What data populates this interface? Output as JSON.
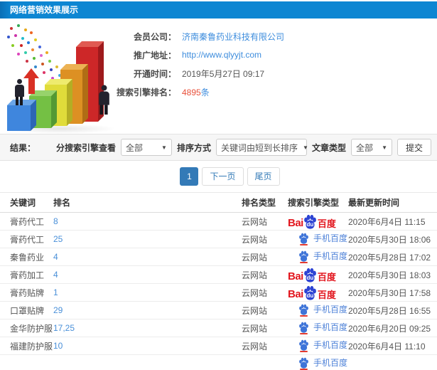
{
  "header": {
    "title": "网络营销效果展示"
  },
  "info": {
    "rows": [
      {
        "label": "会员公司：",
        "value": "济南秦鲁药业科技有限公司",
        "style": "link"
      },
      {
        "label": "推广地址：",
        "value": "http://www.qlyyjt.com",
        "style": "link"
      },
      {
        "label": "开通时间：",
        "value": "2019年5月27日 09:17",
        "style": "plain"
      },
      {
        "label": "搜索引擎排名：",
        "value": "4895",
        "suffix": "条",
        "style": "rank"
      }
    ]
  },
  "filters": {
    "result_label": "结果：",
    "engine_label": "分搜索引擎查看",
    "engine_value": "全部",
    "sort_label": "排序方式",
    "sort_value": "关键词由短到长排序",
    "article_label": "文章类型",
    "article_value": "全部",
    "submit_label": "提交"
  },
  "pagination": {
    "current": "1",
    "next_label": "下一页",
    "last_label": "尾页"
  },
  "table": {
    "headers": [
      "关键词",
      "排名",
      "排名类型",
      "搜索引擎类型",
      "最新更新时间"
    ],
    "engines": {
      "baidu_pc": {
        "bai": "Bai",
        "du": "du",
        "name": "百度"
      },
      "baidu_mobile": {
        "name": "手机百度"
      }
    },
    "rows": [
      {
        "keyword": "膏药代工",
        "rank": "8",
        "rank_type": "云网站",
        "engine": "baidu_pc",
        "updated": "2020年6月4日 11:15"
      },
      {
        "keyword": "膏药代工",
        "rank": "25",
        "rank_type": "云网站",
        "engine": "baidu_mobile",
        "updated": "2020年5月30日 18:06"
      },
      {
        "keyword": "秦鲁药业",
        "rank": "4",
        "rank_type": "云网站",
        "engine": "baidu_mobile",
        "updated": "2020年5月28日 17:02"
      },
      {
        "keyword": "膏药加工",
        "rank": "4",
        "rank_type": "云网站",
        "engine": "baidu_pc",
        "updated": "2020年5月30日 18:03"
      },
      {
        "keyword": "膏药贴牌",
        "rank": "1",
        "rank_type": "云网站",
        "engine": "baidu_pc",
        "updated": "2020年5月30日 17:58"
      },
      {
        "keyword": "口罩贴牌",
        "rank": "29",
        "rank_type": "云网站",
        "engine": "baidu_mobile",
        "updated": "2020年5月28日 16:55"
      },
      {
        "keyword": "金华防护服",
        "rank": "17,25",
        "rank_type": "云网站",
        "engine": "baidu_mobile",
        "updated": "2020年6月20日 09:25"
      },
      {
        "keyword": "福建防护服",
        "rank": "10",
        "rank_type": "云网站",
        "engine": "baidu_mobile",
        "updated": "2020年6月4日 11:10"
      },
      {
        "keyword": "",
        "rank": "",
        "rank_type": "",
        "engine": "baidu_mobile",
        "updated": "",
        "partial": true
      }
    ]
  },
  "colors": {
    "header_blue": "#0d86d2",
    "link_blue": "#3e8ddd",
    "highlight_red": "#e8503a",
    "baidu_red": "#e2171f",
    "baidu_blue": "#2d43d3",
    "mobile_baidu_blue": "#4e82d8",
    "pagination_blue": "#337ab7"
  }
}
